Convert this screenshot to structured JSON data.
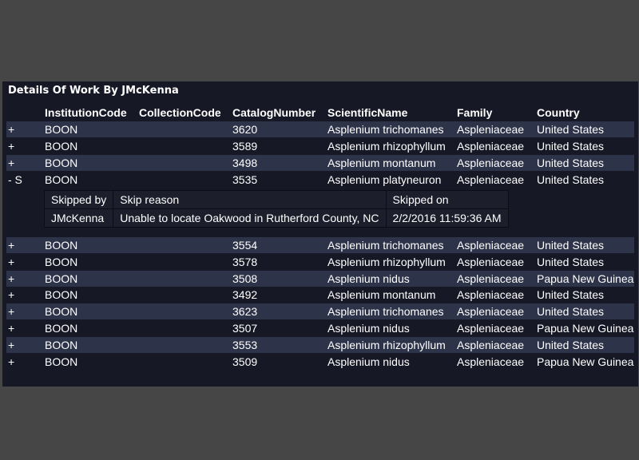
{
  "panel": {
    "title": "Details Of Work By JMcKenna",
    "columns": [
      "InstitutionCode",
      "CollectionCode",
      "CatalogNumber",
      "ScientificName",
      "Family",
      "Country"
    ],
    "rows": [
      {
        "expander": "+",
        "institution": "BOON",
        "collection": "",
        "catalog": "3620",
        "scientific": "Asplenium trichomanes",
        "family": "Aspleniaceae",
        "country": "United States"
      },
      {
        "expander": "+",
        "institution": "BOON",
        "collection": "",
        "catalog": "3589",
        "scientific": "Asplenium rhizophyllum",
        "family": "Aspleniaceae",
        "country": "United States"
      },
      {
        "expander": "+",
        "institution": "BOON",
        "collection": "",
        "catalog": "3498",
        "scientific": "Asplenium montanum",
        "family": "Aspleniaceae",
        "country": "United States"
      },
      {
        "expander": "- S",
        "institution": "BOON",
        "collection": "",
        "catalog": "3535",
        "scientific": "Asplenium platyneuron",
        "family": "Aspleniaceae",
        "country": "United States"
      },
      {
        "expander": "+",
        "institution": "BOON",
        "collection": "",
        "catalog": "3554",
        "scientific": "Asplenium trichomanes",
        "family": "Aspleniaceae",
        "country": "United States"
      },
      {
        "expander": "+",
        "institution": "BOON",
        "collection": "",
        "catalog": "3578",
        "scientific": "Asplenium rhizophyllum",
        "family": "Aspleniaceae",
        "country": "United States"
      },
      {
        "expander": "+",
        "institution": "BOON",
        "collection": "",
        "catalog": "3508",
        "scientific": "Asplenium nidus",
        "family": "Aspleniaceae",
        "country": "Papua New Guinea"
      },
      {
        "expander": "+",
        "institution": "BOON",
        "collection": "",
        "catalog": "3492",
        "scientific": "Asplenium montanum",
        "family": "Aspleniaceae",
        "country": "United States"
      },
      {
        "expander": "+",
        "institution": "BOON",
        "collection": "",
        "catalog": "3623",
        "scientific": "Asplenium trichomanes",
        "family": "Aspleniaceae",
        "country": "United States"
      },
      {
        "expander": "+",
        "institution": "BOON",
        "collection": "",
        "catalog": "3507",
        "scientific": "Asplenium nidus",
        "family": "Aspleniaceae",
        "country": "Papua New Guinea"
      },
      {
        "expander": "+",
        "institution": "BOON",
        "collection": "",
        "catalog": "3553",
        "scientific": "Asplenium rhizophyllum",
        "family": "Aspleniaceae",
        "country": "United States"
      },
      {
        "expander": "+",
        "institution": "BOON",
        "collection": "",
        "catalog": "3509",
        "scientific": "Asplenium nidus",
        "family": "Aspleniaceae",
        "country": "Papua New Guinea"
      }
    ],
    "skip_detail": {
      "headers": [
        "Skipped by",
        "Skip reason",
        "Skipped on"
      ],
      "values": [
        "JMcKenna",
        "Unable to locate Oakwood in Rutherford County, NC",
        "2/2/2016 11:59:36 AM"
      ]
    }
  },
  "colors": {
    "background": "#464646",
    "panel": "#171826",
    "row_alt": "#2d3349",
    "expander": "#ff5a33"
  }
}
